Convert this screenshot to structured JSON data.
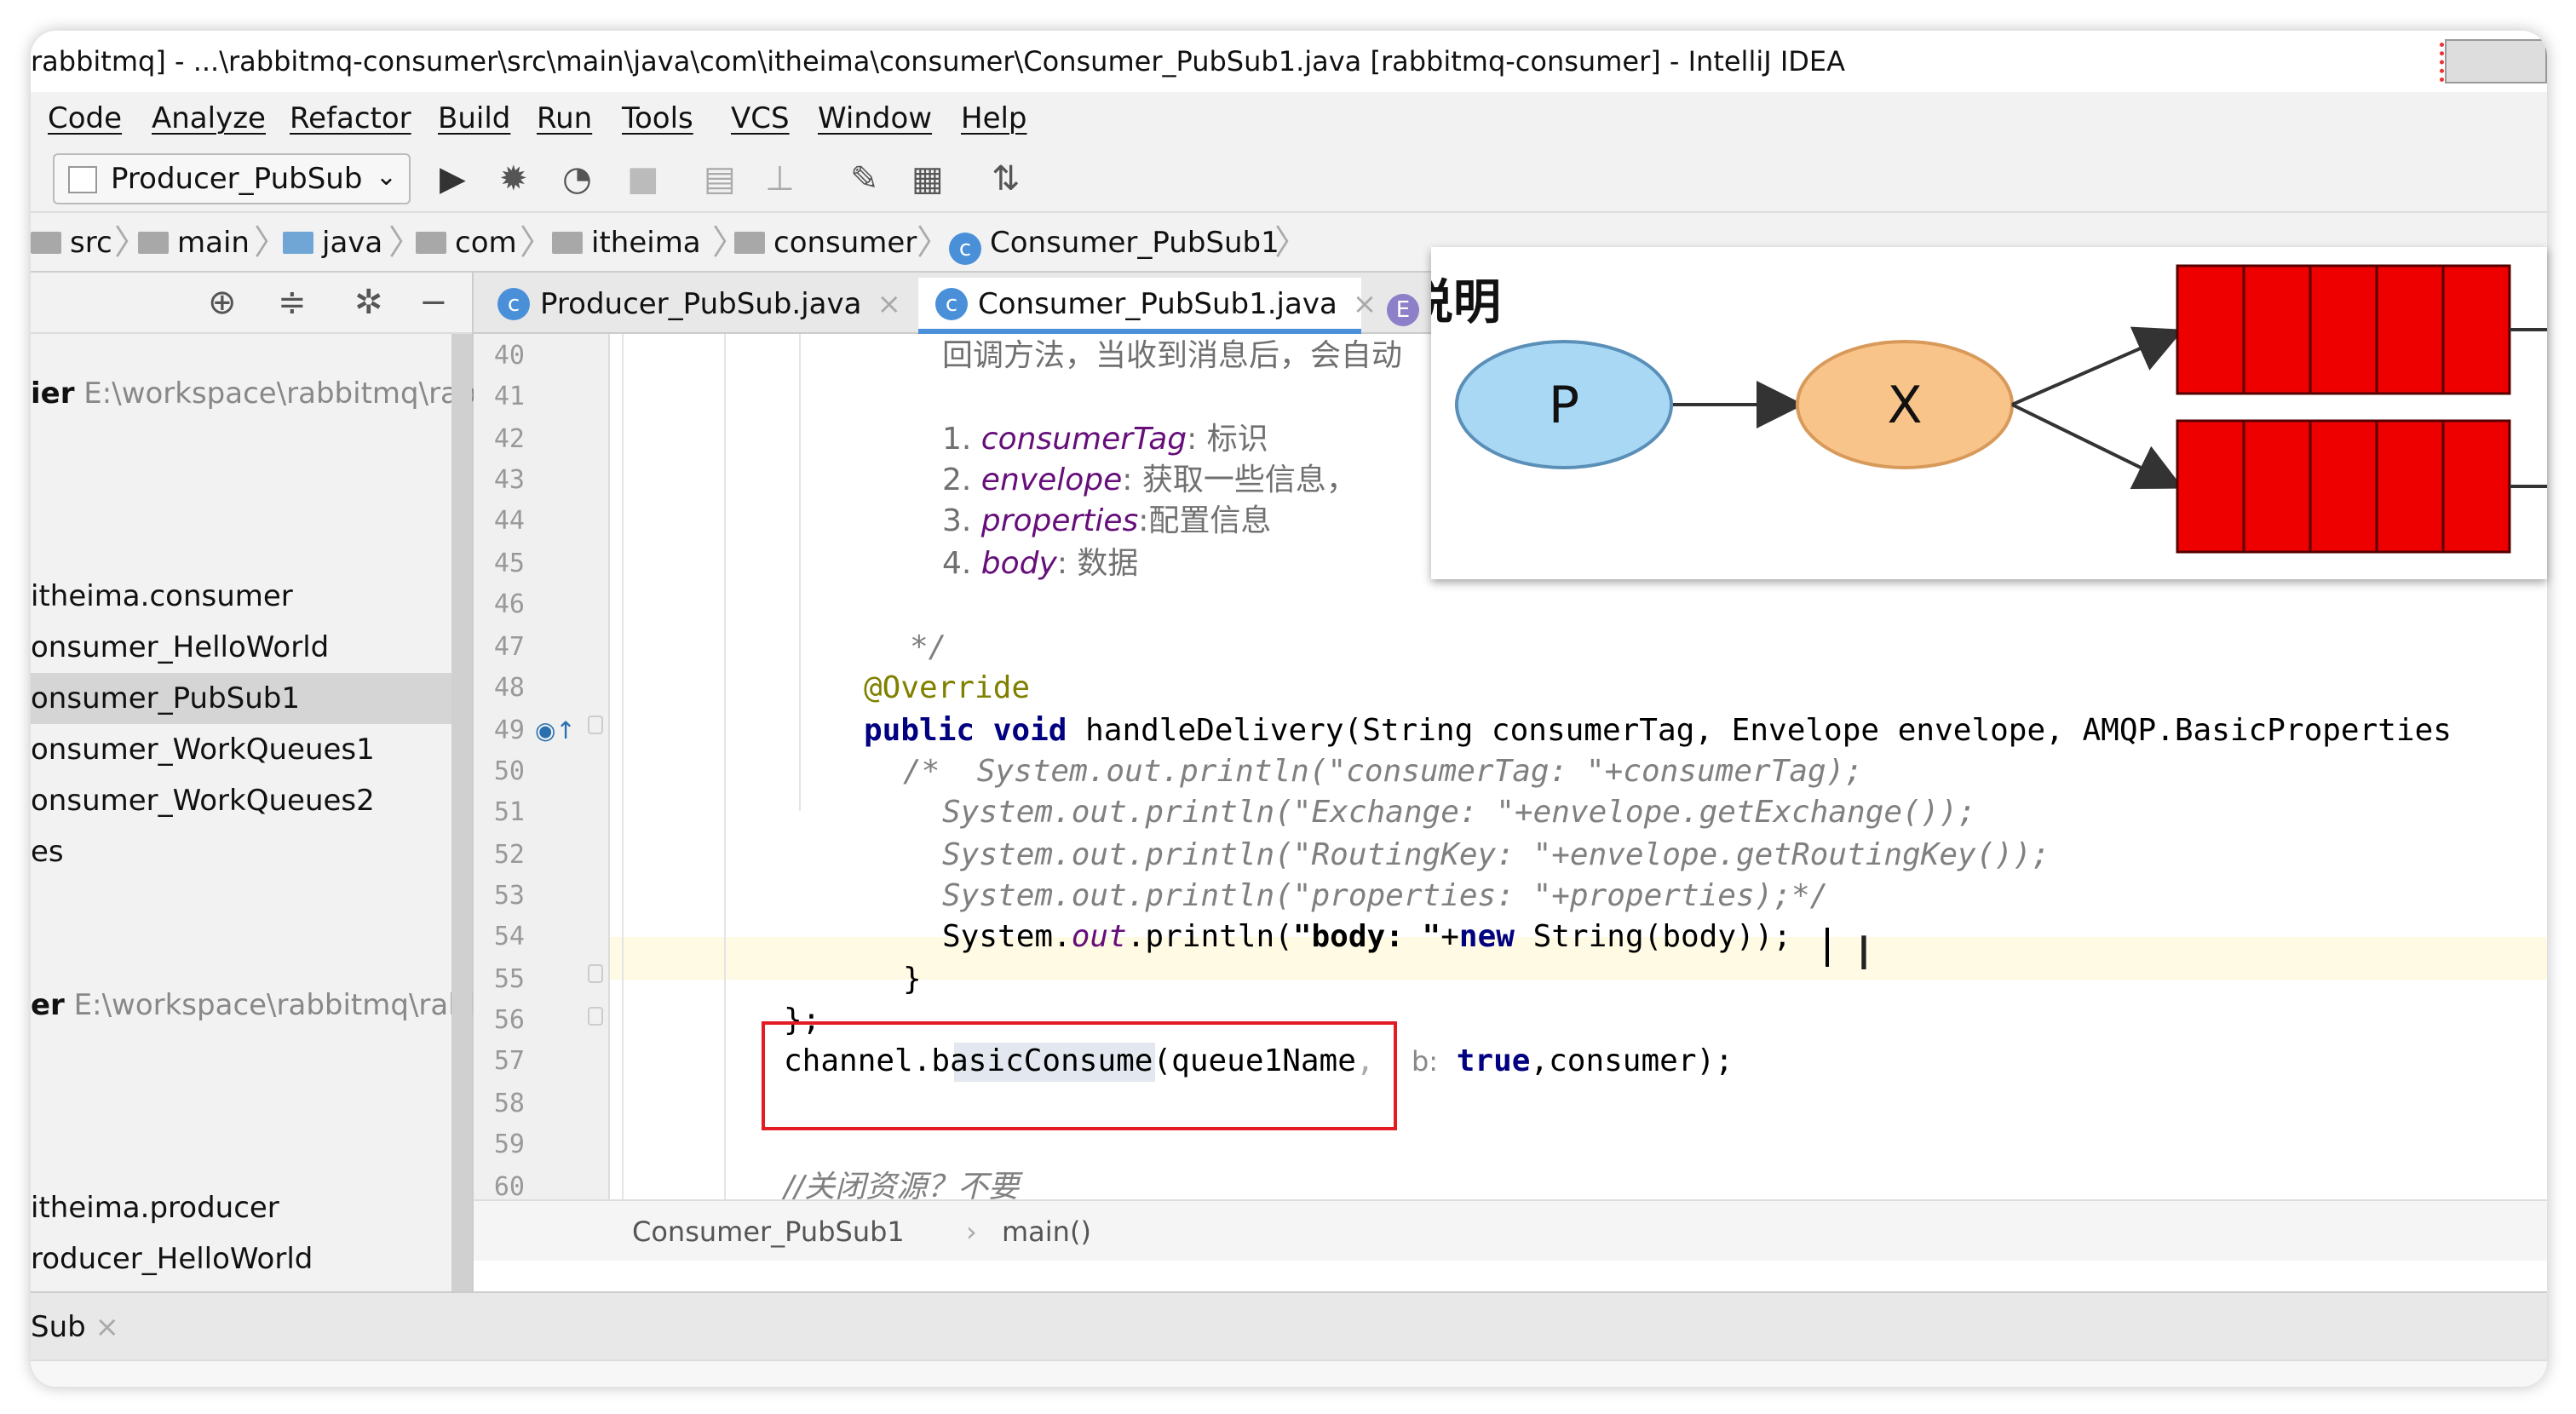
{
  "window": {
    "title": "rabbitmq] - ...\\rabbitmq-consumer\\src\\main\\java\\com\\itheima\\consumer\\Consumer_PubSub1.java [rabbitmq-consumer] - IntelliJ IDEA"
  },
  "menu": [
    "Code",
    "Analyze",
    "Refactor",
    "Build",
    "Run",
    "Tools",
    "VCS",
    "Window",
    "Help"
  ],
  "toolbar": {
    "run_config": "Producer_PubSub",
    "chevron": "⌄",
    "icons": [
      "run-icon",
      "debug-icon",
      "coverage-icon",
      "stop-icon",
      "project-structure-icon",
      "build-icon",
      "settings-wrench-icon",
      "sdk-icon",
      "vcs-icon"
    ]
  },
  "breadcrumbs": [
    "src",
    "main",
    "java",
    "com",
    "itheima",
    "consumer",
    "Consumer_PubSub1"
  ],
  "project": {
    "items": [
      {
        "bold": "ier",
        "path": "E:\\workspace\\rabbitmq\\rab"
      },
      {
        "text": "itheima.consumer"
      },
      {
        "text": "onsumer_HelloWorld"
      },
      {
        "text": "onsumer_PubSub1"
      },
      {
        "text": "onsumer_WorkQueues1"
      },
      {
        "text": "onsumer_WorkQueues2"
      },
      {
        "text": "es"
      },
      {
        "bold": "er",
        "path": "E:\\workspace\\rabbitmq\\rabl"
      },
      {
        "text": "itheima.producer"
      },
      {
        "text": "roducer_HelloWorld"
      }
    ]
  },
  "tabs": [
    {
      "label": "Producer_PubSub.java",
      "close": "×"
    },
    {
      "label": "Consumer_PubSub1.java",
      "close": "×"
    },
    {
      "label": "E"
    }
  ],
  "editor": {
    "line_numbers": [
      "40",
      "41",
      "42",
      "43",
      "44",
      "45",
      "46",
      "47",
      "48",
      "49",
      "50",
      "51",
      "52",
      "53",
      "54",
      "55",
      "56",
      "57",
      "58",
      "59",
      "60"
    ],
    "lines": {
      "l40": "回调方法，当收到消息后，会自动",
      "l42a": "1. ",
      "l42b": "consumerTag",
      "l42c": ": 标识",
      "l43a": "2. ",
      "l43b": "envelope",
      "l43c": ": 获取一些信息，",
      "l44a": "3. ",
      "l44b": "properties",
      "l44c": ":配置信息",
      "l45a": "4. ",
      "l45b": "body",
      "l45c": ": 数据",
      "l47": "*/",
      "l48": "@Override",
      "l49a": "public void ",
      "l49b": "handleDelivery(String consumerTag, Envelope envelope, AMQP.BasicProperties",
      "l50": "/*  System.out.println(\"consumerTag: \"+consumerTag);",
      "l51": "System.out.println(\"Exchange: \"+envelope.getExchange());",
      "l52": "System.out.println(\"RoutingKey: \"+envelope.getRoutingKey());",
      "l53": "System.out.println(\"properties: \"+properties);*/",
      "l54a": "System.",
      "l54b": "out",
      "l54c": ".println(",
      "l54d": "\"body: \"",
      "l54e": "+",
      "l54f": "new ",
      "l54g": "String(body));",
      "l55": "}",
      "l56": "};",
      "l57a": "channel.basicConsume(",
      "l57b": "queue1Name",
      "l57c": ",",
      "l57d": "b:",
      "l57e": " true",
      "l57f": ",consumer);",
      "l60": "//关闭资源？不要"
    },
    "crumb_class": "Consumer_PubSub1",
    "crumb_sep": "›",
    "crumb_method": "main()"
  },
  "bottom_tab": {
    "label": "Sub",
    "close": "×"
  },
  "overlay": {
    "title": "说明",
    "node_p": "P",
    "node_x": "X",
    "colors": {
      "p_fill": "#a9d8f5",
      "x_fill": "#f9c48a",
      "queue_fill": "#ee0000"
    }
  }
}
